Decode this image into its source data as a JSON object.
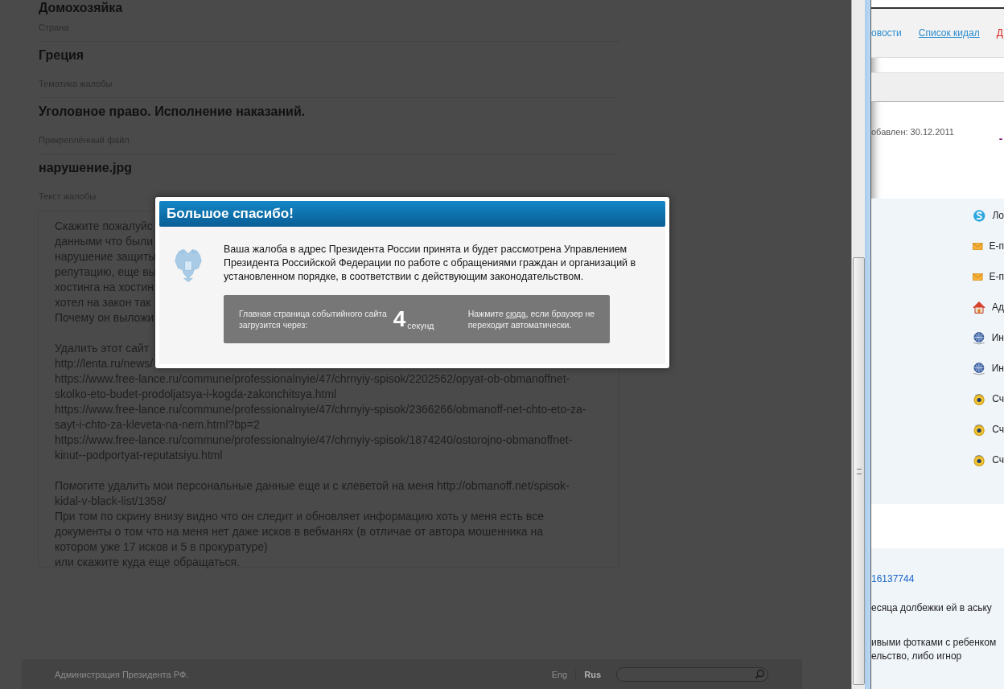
{
  "page": {
    "top_value": "Домохозяйка",
    "fields": [
      {
        "label": "Страна",
        "value": "Греция"
      },
      {
        "label": "Тематика жалобы",
        "value": "Уголовное право. Исполнение наказаний."
      },
      {
        "label": "Прикреплённый файл",
        "value": "нарушение.jpg"
      }
    ],
    "complaint_label": "Текст жалобы",
    "complaint_paragraphs": [
      [
        "Скажите пожалуйс",
        "данными что были",
        "нарушение защиты",
        "репутацию, еще вы",
        "хостинга на хостин",
        "хотел на закон так",
        "Почему он выложи"
      ],
      [
        "Удалить этот сайт",
        "http://lenta.ru/news/",
        "https://www.free-lance.ru/commune/professionalnyie/47/chrnyiy-spisok/2202562/opyat-ob-obmanoffnet-",
        "skolko-eto-budet-prodoljatsya-i-kogda-zakonchitsya.html",
        "https://www.free-lance.ru/commune/professionalnyie/47/chrnyiy-spisok/2366266/obmanoff-net-chto-eto-za-",
        "sayt-i-chto-za-kleveta-na-nem.html?bp=2",
        "https://www.free-lance.ru/commune/professionalnyie/47/chrnyiy-spisok/1874240/ostorojno-obmanoffnet-",
        "kinut--podportyat-reputatsiyu.html"
      ],
      [
        "Помогите удалить мои персональные данные еще и с клеветой на меня http://obmanoff.net/spisok-",
        "kidal-v-black-list/1358/",
        "При том по скрину внизу видно что он следит и обновляет информацию хоть у меня есть все",
        "документы о том что на меня нет даже исков в вебманях (в отличае от автора мошенника на",
        "котором уже 17 исков и 5 в прокуратуре)",
        "или скажите куда еще обращаться."
      ]
    ]
  },
  "footer": {
    "copyright": "Администрация Президента РФ.",
    "languages": [
      {
        "label": "Eng",
        "selected": false
      },
      {
        "label": "Rus",
        "selected": true
      }
    ]
  },
  "dialog": {
    "title": "Большое спасибо!",
    "message": "Ваша жалоба в адрес Президента России принята и будет рассмотрена Управлением Президента Российской Федерации по работе с обращениями граждан и организаций в установленном порядке, в соответствии с действующим законодательством.",
    "countdown_text": "Главная страница событийного сайта загрузится через:",
    "countdown_number": "4",
    "countdown_unit": "секунд",
    "redirect_before": "Нажмите ",
    "redirect_link": "сюда",
    "redirect_after": ", если браузер не переходит автоматически."
  },
  "side_window": {
    "nav": [
      {
        "label": "овости",
        "kind": "plain"
      },
      {
        "label": "Список кидал",
        "kind": "underlined"
      },
      {
        "label": "Д",
        "kind": "red"
      }
    ],
    "added": "обавлен: 30.12.2011",
    "mark": "-",
    "contacts": [
      {
        "kind": "skype",
        "label": "Ло"
      },
      {
        "kind": "mail",
        "label": "E-п"
      },
      {
        "kind": "mail",
        "label": "E-п"
      },
      {
        "kind": "home",
        "label": "Ад"
      },
      {
        "kind": "globe",
        "label": "Ин"
      },
      {
        "kind": "globe",
        "label": "Ин"
      },
      {
        "kind": "coin",
        "label": "Сч"
      },
      {
        "kind": "coin",
        "label": "Сч"
      },
      {
        "kind": "coin",
        "label": "Сч"
      }
    ],
    "number_link": "16137744",
    "text_lines": [
      "есяца долбежки ей в аську",
      "ивыми фотками с ребенком",
      "ельство, либо игнор"
    ]
  }
}
